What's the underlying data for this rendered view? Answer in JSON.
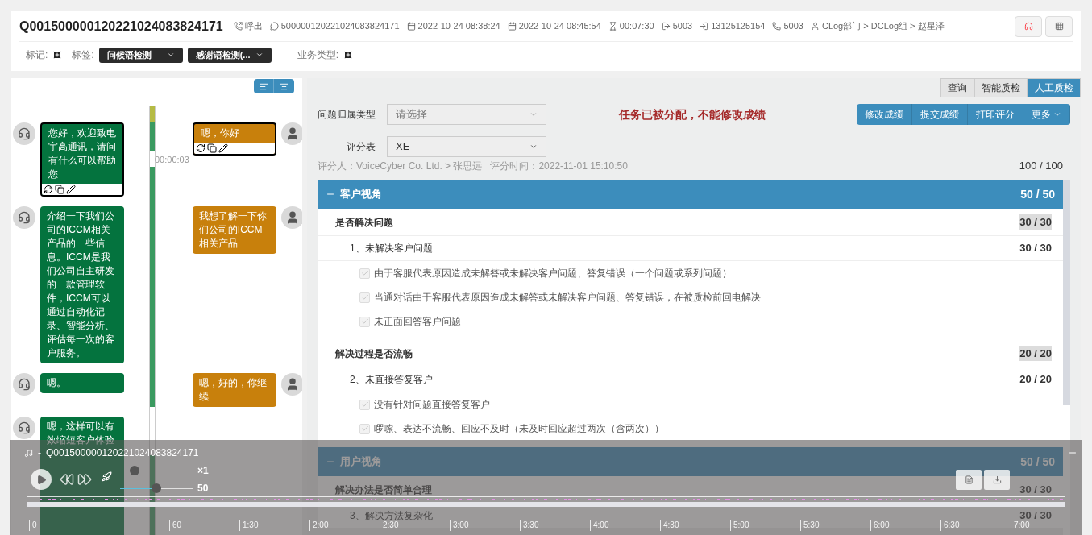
{
  "header": {
    "title": "Q001500000120221024083824171",
    "meta": [
      {
        "kind": "direction",
        "text": "呼出"
      },
      {
        "kind": "message",
        "text": "500000120221024083824171"
      },
      {
        "kind": "calendar",
        "text": "2022-10-24 08:38:24"
      },
      {
        "kind": "calendar",
        "text": "2022-10-24 08:45:54"
      },
      {
        "kind": "duration",
        "text": "00:07:30"
      },
      {
        "kind": "out",
        "text": "5003"
      },
      {
        "kind": "in",
        "text": "13125125154"
      },
      {
        "kind": "phone",
        "text": "5003"
      },
      {
        "kind": "user",
        "text": "CLog部门 > DCLog组 > 赵星泽"
      }
    ],
    "mark_label": "标记:",
    "tag_label": "标签:",
    "tags": [
      "问候语检测",
      "感谢语检测(..."
    ],
    "business_label": "业务类型:"
  },
  "chat": {
    "rows": [
      {
        "left": {
          "text": "您好，欢迎致电宇高通讯，请问有什么可以帮助您",
          "toolbar": true
        },
        "right": {
          "text": "嗯，你好",
          "toolbar": true
        },
        "time": "00:00:03"
      },
      {
        "left": {
          "text": "介绍一下我们公司的ICCM相关产品的一些信息。ICCM是我们公司自主研发的一款管理软件，ICCM可以通过自动化记录、智能分析、评估每一次的客户服务。",
          "toolbar": false
        },
        "right": {
          "text": "我想了解一下你们公司的ICCM相关产品",
          "toolbar": false
        }
      },
      {
        "left": {
          "text": "嗯。",
          "toolbar": false
        },
        "right": {
          "text": "嗯，好的，你继续",
          "toolbar": false
        }
      },
      {
        "left": {
          "text": "嗯，这样可以有效缩短客户体验",
          "toolbar": false
        }
      }
    ]
  },
  "tabs": [
    {
      "label": "查询",
      "selected": false
    },
    {
      "label": "智能质检",
      "selected": false
    },
    {
      "label": "人工质检",
      "selected": true
    }
  ],
  "form": {
    "type_label": "问题归属类型",
    "type_placeholder": "请选择",
    "warning": "任务已被分配，不能修改成绩",
    "actions": [
      "修改成绩",
      "提交成绩",
      "打印评分",
      "更多"
    ],
    "sheet_label": "评分表",
    "sheet_value": "XE",
    "rater": "评分人：VoiceCyber Co. Ltd. > 张思远   评分时间：2022-11-01 15:10:50",
    "total": "100 / 100"
  },
  "sections": [
    {
      "title": "客户视角",
      "score": "50 / 50",
      "expanded": true,
      "criteria": [
        {
          "title": "是否解决问题",
          "score": "30 / 30",
          "highlighted": true,
          "items": [
            {
              "title": "1、未解决客户问题",
              "score": "30 / 30",
              "checks": [
                {
                  "label": "由于客服代表原因造成未解答或未解决客户问题、答复错误（一个问题或系列问题）",
                  "checked": true,
                  "disabled": true
                },
                {
                  "label": "当通对话由于客服代表原因造成未解答或未解决客户问题、答复错误，在被质检前回电解决",
                  "checked": true,
                  "disabled": true
                },
                {
                  "label": "未正面回答客户问题",
                  "checked": true,
                  "disabled": true
                }
              ]
            }
          ]
        },
        {
          "title": "解决过程是否流畅",
          "score": "20 / 20",
          "highlighted": true,
          "items": [
            {
              "title": "2、未直接答复客户",
              "score": "20 / 20",
              "checks": [
                {
                  "label": "没有针对问题直接答复客户",
                  "checked": true,
                  "disabled": true
                },
                {
                  "label": "啰嗦、表达不流畅、回应不及时（未及时回应超过两次（含两次））",
                  "checked": true,
                  "disabled": true
                }
              ]
            }
          ]
        }
      ]
    },
    {
      "title": "用户视角",
      "score": "50 / 50",
      "expanded": true,
      "criteria": [
        {
          "title": "解决办法是否简单合理",
          "score": "30 / 30",
          "highlighted": false,
          "items": [
            {
              "title": "3、解决方法复杂化",
              "score": "30 / 30"
            }
          ]
        }
      ]
    }
  ],
  "player": {
    "separator": "-",
    "title": "Q001500000120221024083824171",
    "speed": {
      "reading": "×1",
      "level": 0.2
    },
    "volume": {
      "reading": "50",
      "level": 0.5
    },
    "ticks": [
      "0",
      "60",
      "1:30",
      "2:00",
      "2:30",
      "3:00",
      "3:30",
      "4:00",
      "4:30",
      "5:00",
      "5:30",
      "6:00",
      "6:30",
      "7:00"
    ]
  }
}
